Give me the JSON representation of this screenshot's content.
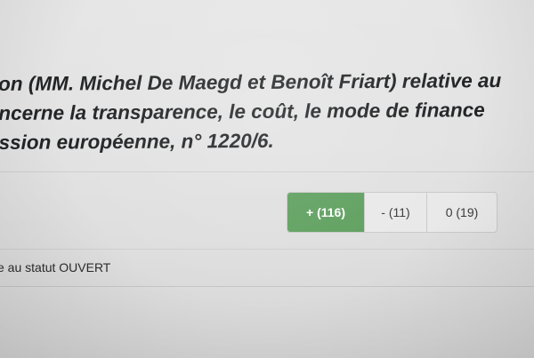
{
  "proposal": {
    "title_lines": [
      "on (MM. Michel De Maegd et Benoît Friart) relative au",
      "ncerne la transparence, le coût, le mode de finance",
      "ssion européenne, n° 1220/6."
    ]
  },
  "votes": {
    "plus_label": "+ (116)",
    "minus_label": "- (11)",
    "zero_label": "0 (19)",
    "plus_color": "#5fa05f"
  },
  "status_text": "e au statut OUVERT"
}
